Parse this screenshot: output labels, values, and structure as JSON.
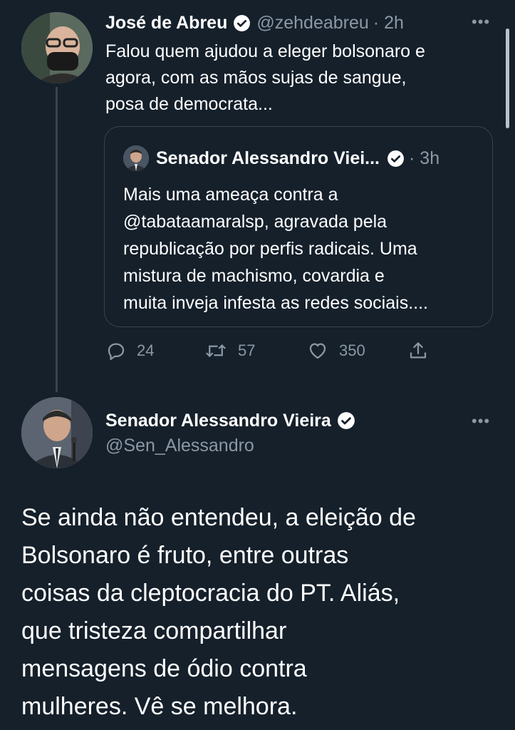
{
  "reply_tweet": {
    "author_name": "José de Abreu",
    "handle": "@zehdeabreu",
    "time": "· 2h",
    "text_lines": [
      "Falou quem ajudou a eleger bolsonaro e",
      "agora, com as mãos sujas de sangue,",
      "posa de democrata..."
    ],
    "quoted": {
      "author_name": "Senador Alessandro Viei...",
      "time": "· 3h",
      "text_lines": [
        "Mais uma ameaça contra a",
        "@tabataamaralsp, agravada pela",
        "republicação por perfis radicais. Uma",
        "mistura de machismo, covardia e",
        "muita inveja infesta as redes sociais...."
      ]
    },
    "actions": {
      "replies": "24",
      "retweets": "57",
      "likes": "350"
    }
  },
  "main_tweet": {
    "author_name": "Senador Alessandro Vieira",
    "handle": "@Sen_Alessandro",
    "text_lines": [
      "Se ainda não entendeu, a eleição de",
      "Bolsonaro é fruto, entre outras",
      "coisas da cleptocracia do PT. Aliás,",
      "que tristeza compartilhar",
      "mensagens de ódio contra",
      "mulheres. Vê se melhora."
    ]
  },
  "icons": {
    "verified": "verified-badge-icon",
    "more": "more-options-icon",
    "reply": "reply-icon",
    "retweet": "retweet-icon",
    "like": "heart-icon",
    "share": "share-icon"
  },
  "colors": {
    "background": "#15202b",
    "text": "#ffffff",
    "secondary_text": "#8b98a5",
    "border": "#38444d"
  }
}
